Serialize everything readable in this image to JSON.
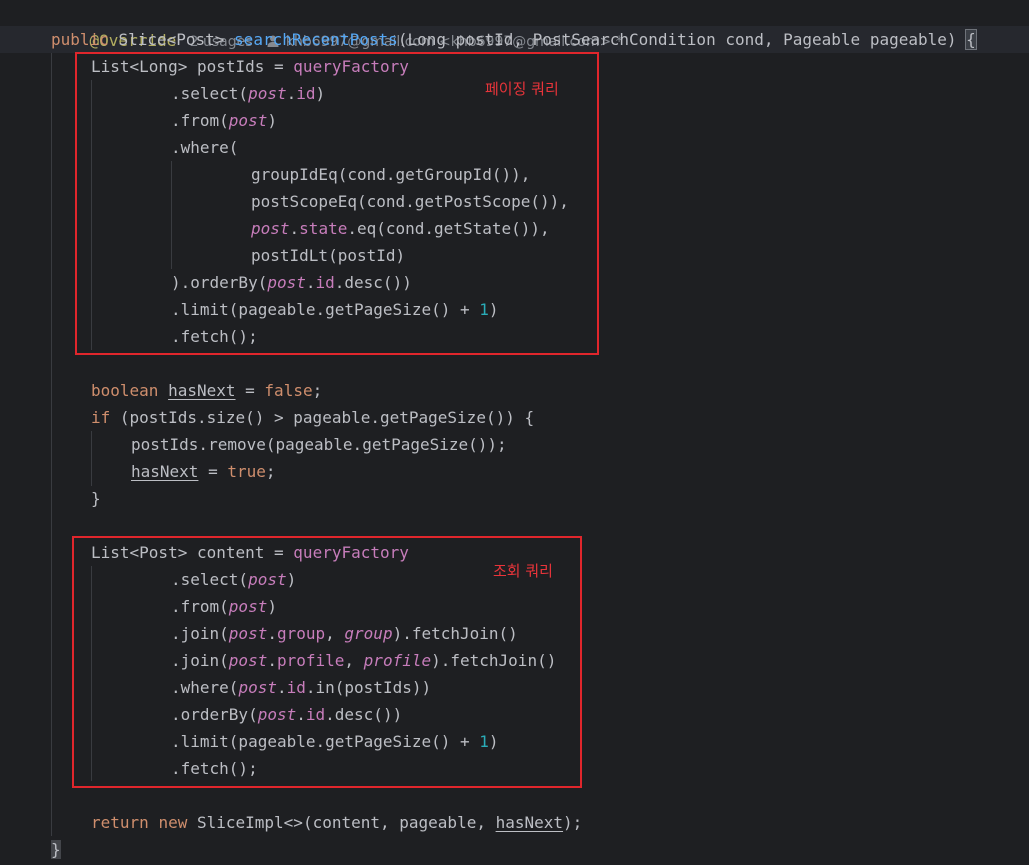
{
  "header": {
    "annotation": "@Override",
    "usages": "2 usages",
    "author": "khb6997@gmail.com <khb6997@gmail.com> *"
  },
  "code": {
    "sig_public": "public",
    "sig_type": "Slice<Post>",
    "sig_method": "searchRecentPosts",
    "sig_params": "(Long postId, PostSearchCondition cond, Pageable pageable)",
    "sig_brace": "{",
    "l1_type": "List<Long> postIds = ",
    "l1_qf": "queryFactory",
    "l2_a": ".select(",
    "l2_post": "post",
    "l2_dot": ".",
    "l2_id": "id",
    "l2_b": ")",
    "l3_a": ".from(",
    "l3_post": "post",
    "l3_b": ")",
    "l4": ".where(",
    "l5": "groupIdEq(cond.getGroupId()),",
    "l6": "postScopeEq(cond.getPostScope()),",
    "l7_post": "post",
    "l7_dot": ".",
    "l7_state": "state",
    "l7_rest": ".eq(cond.getState()),",
    "l8": "postIdLt(postId)",
    "l9_a": ").orderBy(",
    "l9_post": "post",
    "l9_dot": ".",
    "l9_id": "id",
    "l9_b": ".desc())",
    "l10_a": ".limit(pageable.getPageSize() + ",
    "l10_num": "1",
    "l10_b": ")",
    "l11": ".fetch();",
    "b1_kw": "boolean",
    "b1_var": "hasNext",
    "b1_eq": " = ",
    "b1_val": "false",
    "b1_end": ";",
    "b2_kw": "if",
    "b2_rest": " (postIds.size() > pageable.getPageSize()) {",
    "b3": "postIds.remove(pageable.getPageSize());",
    "b4_var": "hasNext",
    "b4_eq": " = ",
    "b4_val": "true",
    "b4_end": ";",
    "b5": "}",
    "c1_type": "List<Post> content = ",
    "c1_qf": "queryFactory",
    "c2_a": ".select(",
    "c2_post": "post",
    "c2_b": ")",
    "c3_a": ".from(",
    "c3_post": "post",
    "c3_b": ")",
    "c4_a": ".join(",
    "c4_post": "post",
    "c4_dot": ".",
    "c4_group": "group",
    "c4_comma": ", ",
    "c4_group2": "group",
    "c4_b": ").fetchJoin()",
    "c5_a": ".join(",
    "c5_post": "post",
    "c5_dot": ".",
    "c5_profile": "profile",
    "c5_comma": ", ",
    "c5_profile2": "profile",
    "c5_b": ").fetchJoin()",
    "c6_a": ".where(",
    "c6_post": "post",
    "c6_dot": ".",
    "c6_id": "id",
    "c6_b": ".in(postIds))",
    "c7_a": ".orderBy(",
    "c7_post": "post",
    "c7_dot": ".",
    "c7_id": "id",
    "c7_b": ".desc())",
    "c8_a": ".limit(pageable.getPageSize() + ",
    "c8_num": "1",
    "c8_b": ")",
    "c9": ".fetch();",
    "r_kw1": "return",
    "r_kw2": "new",
    "r_a": " SliceImpl<>(content, pageable, ",
    "r_var": "hasNext",
    "r_b": ");",
    "end_brace": "}"
  },
  "annotations": {
    "paging_label": "페이징 쿼리",
    "query_label": "조회 쿼리"
  },
  "colors": {
    "background": "#1e1f22",
    "keyword": "#cf8e6d",
    "method": "#56a8f5",
    "field": "#c77dbb",
    "number": "#2aacb8",
    "annotation": "#b3ae60",
    "highlight_box": "#e0262c"
  }
}
